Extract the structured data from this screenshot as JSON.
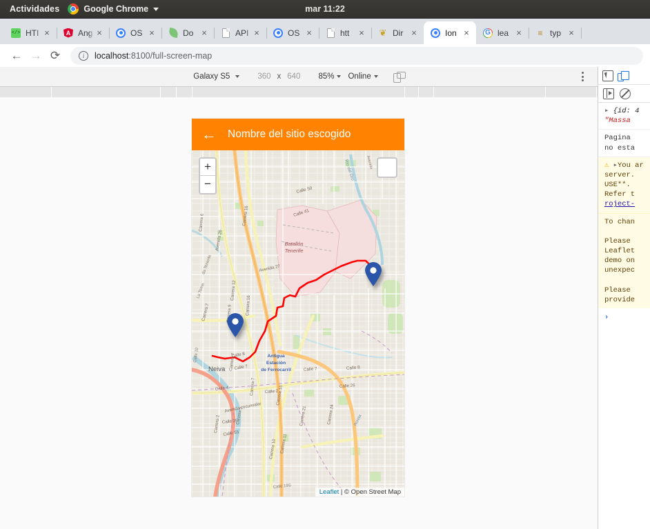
{
  "gnome": {
    "activities": "Actividades",
    "app_name": "Google Chrome",
    "chrome_icon": "chrome-logo-icon",
    "appmenu_caret": "chevron-down-icon",
    "clock": "mar 11:22"
  },
  "browser": {
    "tabs": [
      {
        "label": "HTI",
        "icon": "html-file-icon",
        "icon_class": "fav-html",
        "active": false,
        "close": "×"
      },
      {
        "label": "Ang",
        "icon": "angular-icon",
        "icon_class": "fav-ng",
        "active": false,
        "close": "×"
      },
      {
        "label": "OS",
        "icon": "ionic-icon",
        "icon_class": "fav-ion",
        "active": false,
        "close": "×"
      },
      {
        "label": "Do",
        "icon": "leaf-icon",
        "icon_class": "fav-leaf",
        "active": false,
        "close": "×"
      },
      {
        "label": "API",
        "icon": "document-icon",
        "icon_class": "fav-doc",
        "active": false,
        "close": "×"
      },
      {
        "label": "OS",
        "icon": "ionic-icon",
        "icon_class": "fav-ion",
        "active": false,
        "close": "×"
      },
      {
        "label": "htt",
        "icon": "document-icon",
        "icon_class": "fav-doc",
        "active": false,
        "close": "×"
      },
      {
        "label": "Dir",
        "icon": "dove-icon",
        "icon_class": "fav-dir",
        "active": false,
        "close": "×"
      },
      {
        "label": "Ion",
        "icon": "ionic-icon",
        "icon_class": "fav-ion",
        "active": true,
        "close": "×"
      },
      {
        "label": "lea",
        "icon": "google-icon",
        "icon_class": "fav-g",
        "active": false,
        "close": "×"
      },
      {
        "label": "typ",
        "icon": "typescript-icon",
        "icon_class": "fav-ts",
        "active": false,
        "close": "×"
      }
    ],
    "nav": {
      "back": "←",
      "forward": "→",
      "reload": "⟳",
      "site_info_icon": "info-circle-icon"
    },
    "url_host": "localhost",
    "url_rest": ":8100/full-screen-map"
  },
  "device_toolbar": {
    "device_name": "Galaxy S5",
    "device_caret": "chevron-down-icon",
    "width": "360",
    "times": "x",
    "height": "640",
    "zoom": "85%",
    "zoom_caret": "chevron-down-icon",
    "throttling": "Online",
    "throttling_caret": "chevron-down-icon",
    "rotate_icon": "rotate-device-icon",
    "more_icon": "kebab-menu-icon"
  },
  "app": {
    "header": {
      "back_icon": "arrow-left-icon",
      "title": "Nombre del sitio escogido",
      "accent_color": "#ff8300"
    },
    "map": {
      "zoom_in": "+",
      "zoom_out": "−",
      "layers_icon": "layers-control-icon",
      "attribution_link": "Leaflet",
      "attribution_rest": " | © Open Street Map",
      "route_color": "#ff0000",
      "marker_color": "#2b55a8",
      "place_labels": [
        "Batallón Tenerife",
        "Neiva",
        "Antigua Estación de Ferrocarril",
        "Carrera 16",
        "Carrera 6",
        "Carrera 7",
        "Carrera 9",
        "Carrera 12",
        "Carrera 2",
        "Carrera 5",
        "Carrera 15",
        "Carrera 10",
        "Carrera 11",
        "Carrera 21",
        "Carrera 24",
        "Avenida 26",
        "Avenida 27",
        "Avenida circunvalar",
        "Calle 50",
        "Calle 41",
        "Calle 25",
        "Calle 55",
        "Calle 8",
        "Calle 7",
        "Calle 4",
        "Calle 2",
        "Calle 26",
        "Calle 10",
        "Calle 19S",
        "Río del Oro",
        "La Toma"
      ],
      "markers": [
        {
          "name": "origin-marker"
        },
        {
          "name": "destination-marker"
        }
      ]
    }
  },
  "devtools": {
    "tabs_icons": [
      {
        "name": "inspect-element-icon"
      },
      {
        "name": "toggle-device-toolbar-icon"
      }
    ],
    "toolbar_icons": [
      {
        "name": "console-sidebar-icon"
      },
      {
        "name": "clear-console-icon"
      }
    ],
    "console_rows": [
      {
        "type": "object",
        "expander": "▸",
        "text": "{id: 4",
        "str": "\"Massa"
      },
      {
        "type": "log",
        "lines": [
          "Pagina",
          "no esta"
        ]
      },
      {
        "type": "warn",
        "icon": "warning-icon",
        "expander": "▸",
        "lines": [
          "You ar",
          "server.",
          "USE**.",
          "Refer t"
        ],
        "link": "roject-"
      },
      {
        "type": "warn",
        "lines": [
          "",
          "To chan",
          "",
          "Please",
          "Leaflet",
          "demo on",
          "unexpec",
          "",
          "Please",
          "provide"
        ]
      }
    ],
    "prompt": "›"
  }
}
